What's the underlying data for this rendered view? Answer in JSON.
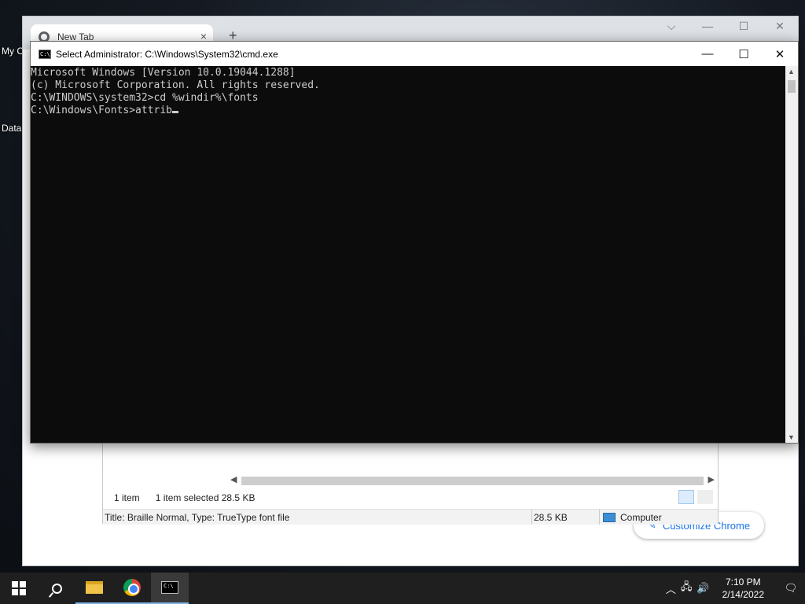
{
  "desktop": {
    "icons": [
      {
        "label": "My C",
        "icon": "this-pc-icon"
      },
      {
        "label": "Data",
        "icon": "shortcut-icon"
      }
    ]
  },
  "chrome": {
    "tab_title": "New Tab",
    "new_tab_symbol": "+",
    "close_symbol": "×",
    "customize_label": "Customize Chrome"
  },
  "explorer": {
    "item_count": "1 item",
    "selected": "1 item selected",
    "selected_size": "28.5 KB",
    "details": "Title: Braille Normal, Type: TrueType font file",
    "size": "28.5 KB",
    "location": "Computer"
  },
  "cmd": {
    "title": "Select Administrator: C:\\Windows\\System32\\cmd.exe",
    "lines": [
      "Microsoft Windows [Version 10.0.19044.1288]",
      "(c) Microsoft Corporation. All rights reserved.",
      "",
      "C:\\WINDOWS\\system32>cd %windir%\\fonts",
      "",
      "C:\\Windows\\Fonts>attrib"
    ]
  },
  "taskbar": {
    "time": "7:10 PM",
    "date": "2/14/2022"
  },
  "colors": {
    "console_bg": "#0c0c0c",
    "console_fg": "#cccccc",
    "taskbar_bg": "#1f1f1f",
    "accent": "#1a73e8"
  }
}
